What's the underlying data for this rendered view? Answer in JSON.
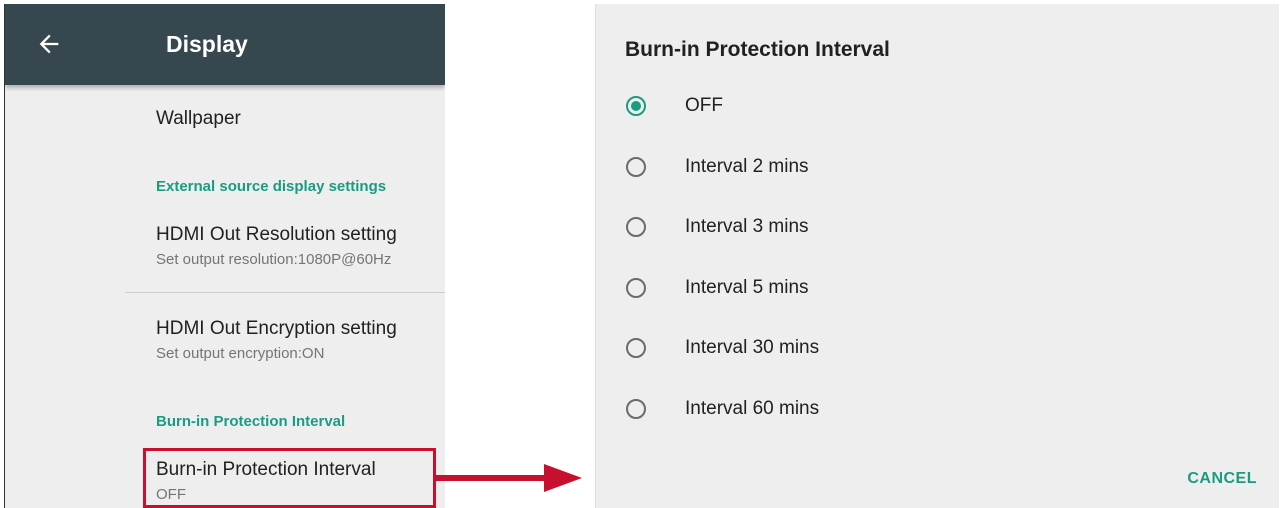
{
  "left_panel": {
    "title": "Display",
    "items": [
      {
        "type": "item",
        "title": "Wallpaper"
      },
      {
        "type": "header",
        "title": "External source display settings"
      },
      {
        "type": "item",
        "title": "HDMI Out Resolution setting",
        "subtitle": "Set output resolution:1080P@60Hz"
      },
      {
        "type": "item",
        "title": "HDMI Out Encryption setting",
        "subtitle": "Set output encryption:ON"
      },
      {
        "type": "header",
        "title": "Burn-in Protection Interval"
      },
      {
        "type": "item",
        "title": "Burn-in Protection Interval",
        "subtitle": "OFF"
      }
    ]
  },
  "dialog": {
    "title": "Burn-in Protection Interval",
    "options": [
      {
        "label": "OFF",
        "checked": true
      },
      {
        "label": "Interval 2 mins",
        "checked": false
      },
      {
        "label": "Interval 3 mins",
        "checked": false
      },
      {
        "label": "Interval 5 mins",
        "checked": false
      },
      {
        "label": "Interval 30 mins",
        "checked": false
      },
      {
        "label": "Interval 60 mins",
        "checked": false
      }
    ],
    "cancel_label": "CANCEL"
  },
  "colors": {
    "appbar": "#37474f",
    "accent": "#1a9c83",
    "highlight": "#c8102e"
  },
  "icons": {
    "back": "back-arrow-icon",
    "callout_arrow": "arrow-right-icon"
  }
}
